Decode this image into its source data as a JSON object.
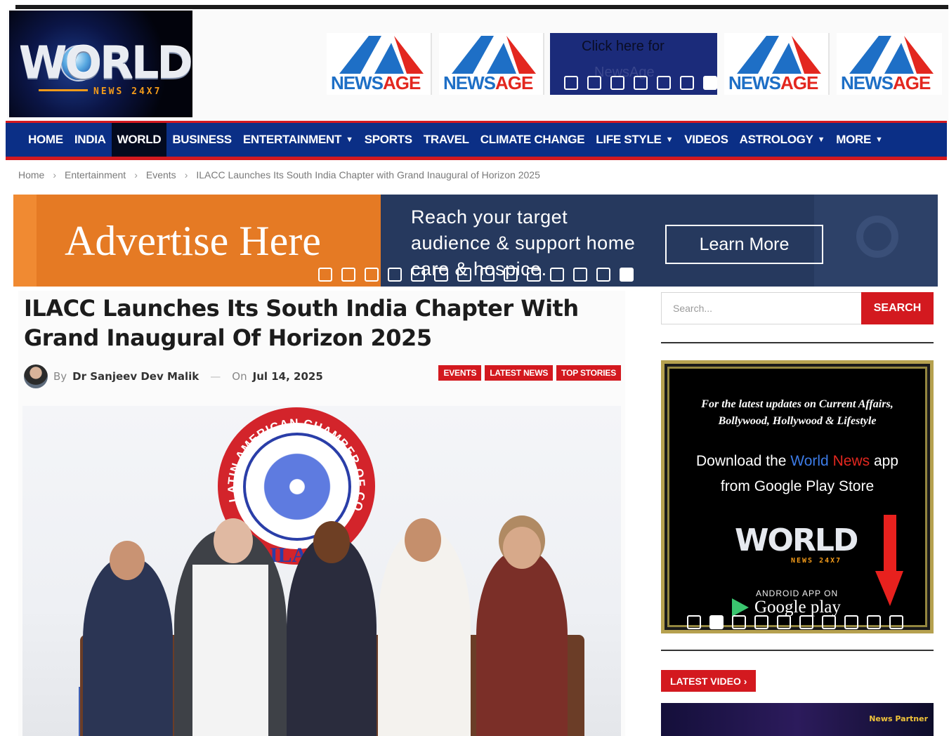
{
  "site": {
    "logo_word": "WORLD",
    "logo_sub": "NEWS 24X7"
  },
  "header_ad": {
    "brand_prefix": "NEWS",
    "brand_suffix": "AGE",
    "click_line1": "Click here for",
    "click_line2": "NewsAge",
    "slides": 7,
    "active_slide": 6
  },
  "nav": {
    "items": [
      {
        "label": "HOME",
        "dropdown": false,
        "active": false
      },
      {
        "label": "INDIA",
        "dropdown": false,
        "active": false
      },
      {
        "label": "WORLD",
        "dropdown": false,
        "active": true
      },
      {
        "label": "BUSINESS",
        "dropdown": false,
        "active": false
      },
      {
        "label": "ENTERTAINMENT",
        "dropdown": true,
        "active": false
      },
      {
        "label": "SPORTS",
        "dropdown": false,
        "active": false
      },
      {
        "label": "TRAVEL",
        "dropdown": false,
        "active": false
      },
      {
        "label": "CLIMATE CHANGE",
        "dropdown": false,
        "active": false
      },
      {
        "label": "LIFE STYLE",
        "dropdown": true,
        "active": false
      },
      {
        "label": "VIDEOS",
        "dropdown": false,
        "active": false
      },
      {
        "label": "ASTROLOGY",
        "dropdown": true,
        "active": false
      },
      {
        "label": "MORE",
        "dropdown": true,
        "active": false
      }
    ]
  },
  "breadcrumb": {
    "home": "Home",
    "level1": "Entertainment",
    "level2": "Events",
    "current": "ILACC Launches Its South India Chapter with Grand Inaugural of Horizon 2025",
    "separator": "›"
  },
  "advert": {
    "title": "Advertise Here",
    "copy": "Reach your target audience & support home care & hospice.",
    "cta": "Learn More",
    "slides": 14,
    "active_slide": 13
  },
  "article": {
    "headline": "ILACC Launches Its South India Chapter With Grand Inaugural Of Horizon 2025",
    "by_label": "By",
    "author": "Dr Sanjeev Dev Malik",
    "dash": "—",
    "on_label": "On",
    "date": "Jul 14, 2025",
    "tags": [
      "EVENTS",
      "LATEST NEWS",
      "TOP STORIES"
    ],
    "photo_emblem_ring": "LATIN AMERICAN CHAMBER OF COMMERCE",
    "photo_emblem_text": "ILACC"
  },
  "sidebar": {
    "search_placeholder": "Search...",
    "search_button": "SEARCH",
    "app_promo": {
      "line1": "For the latest updates on Current Affairs,",
      "line2": "Bollywood, Hollywood & Lifestyle",
      "download_pre": "Download the ",
      "download_world": "World",
      "download_news": "News",
      "download_post": " app",
      "download_line2": "from Google Play Store",
      "logo_word": "WORLD",
      "logo_sub": "NEWS 24X7",
      "android_label": "ANDROID APP ON",
      "store_name": "Google play",
      "slides": 10,
      "active_slide": 1
    },
    "latest_video": "LATEST VIDEO ›",
    "video_overlay": "News Partner"
  },
  "colors": {
    "nav_bg": "#0b2f86",
    "accent_red": "#d3191f",
    "advert_orange": "#e57a24",
    "advert_navy": "#26395e"
  }
}
